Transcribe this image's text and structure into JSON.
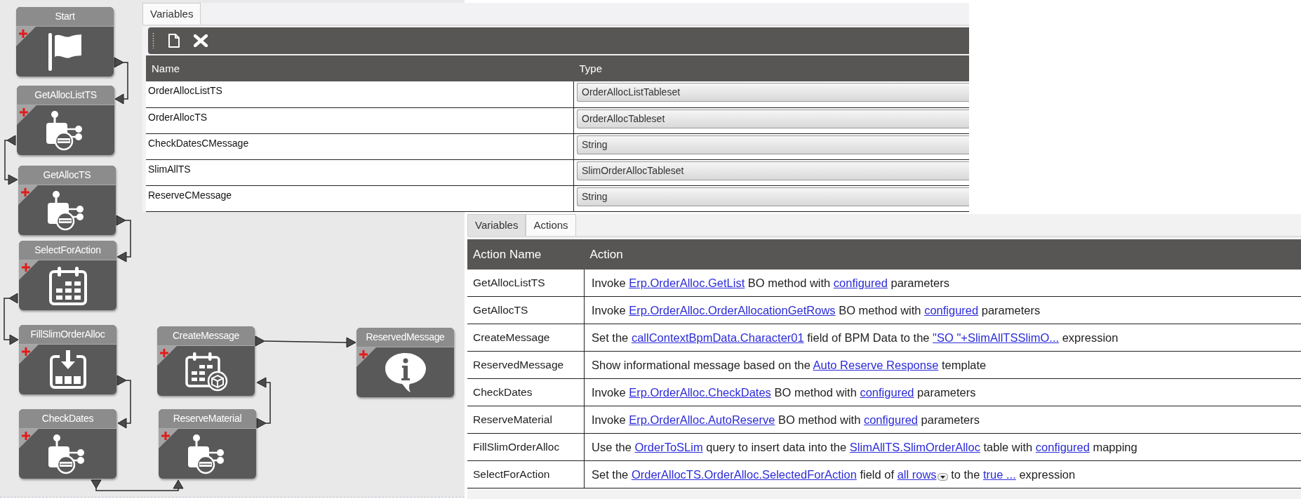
{
  "canvas": {
    "nodes": [
      {
        "title": "Start",
        "kind": "start"
      },
      {
        "title": "GetAllocListTS",
        "kind": "method"
      },
      {
        "title": "GetAllocTS",
        "kind": "method"
      },
      {
        "title": "SelectForAction",
        "kind": "set-argument"
      },
      {
        "title": "FillSlimOrderAlloc",
        "kind": "fill-table"
      },
      {
        "title": "CheckDates",
        "kind": "method"
      },
      {
        "title": "CreateMessage",
        "kind": "set-field"
      },
      {
        "title": "ReserveMaterial",
        "kind": "method"
      },
      {
        "title": "ReservedMessage",
        "kind": "message"
      }
    ]
  },
  "variables_panel": {
    "tabs": [
      {
        "label": "Variables",
        "selected": true
      }
    ],
    "columns": [
      "Name",
      "Type"
    ],
    "rows": [
      {
        "name": "OrderAllocListTS",
        "type": "OrderAllocListTableset"
      },
      {
        "name": "OrderAllocTS",
        "type": "OrderAllocTableset"
      },
      {
        "name": "CheckDatesCMessage",
        "type": "String"
      },
      {
        "name": "SlimAllTS",
        "type": "SlimOrderAllocTableset"
      },
      {
        "name": "ReserveCMessage",
        "type": "String"
      }
    ]
  },
  "actions_panel": {
    "tabs": [
      {
        "label": "Variables",
        "selected": false
      },
      {
        "label": "Actions",
        "selected": true
      }
    ],
    "columns": [
      "Action Name",
      "Action"
    ],
    "rows": [
      {
        "name": "GetAllocListTS",
        "action": [
          {
            "kind": "text",
            "text": "Invoke "
          },
          {
            "kind": "link",
            "text": "Erp.OrderAlloc.GetList"
          },
          {
            "kind": "text",
            "text": " BO method with "
          },
          {
            "kind": "link",
            "text": "configured"
          },
          {
            "kind": "text",
            "text": " parameters"
          }
        ]
      },
      {
        "name": "GetAllocTS",
        "action": [
          {
            "kind": "text",
            "text": "Invoke "
          },
          {
            "kind": "link",
            "text": "Erp.OrderAlloc.OrderAllocationGetRows"
          },
          {
            "kind": "text",
            "text": " BO method with "
          },
          {
            "kind": "link",
            "text": "configured"
          },
          {
            "kind": "text",
            "text": " parameters"
          }
        ]
      },
      {
        "name": "CreateMessage",
        "action": [
          {
            "kind": "text",
            "text": "Set the "
          },
          {
            "kind": "link",
            "text": "callContextBpmData.Character01"
          },
          {
            "kind": "text",
            "text": " field of BPM Data to the "
          },
          {
            "kind": "link",
            "text": "\"SO \"+SlimAllTSSlimO..."
          },
          {
            "kind": "text",
            "text": " expression"
          }
        ]
      },
      {
        "name": "ReservedMessage",
        "action": [
          {
            "kind": "text",
            "text": "Show informational message based on the "
          },
          {
            "kind": "link",
            "text": "Auto Reserve Response"
          },
          {
            "kind": "text",
            "text": " template"
          }
        ]
      },
      {
        "name": "CheckDates",
        "action": [
          {
            "kind": "text",
            "text": "Invoke "
          },
          {
            "kind": "link",
            "text": "Erp.OrderAlloc.CheckDates"
          },
          {
            "kind": "text",
            "text": " BO method with "
          },
          {
            "kind": "link",
            "text": "configured"
          },
          {
            "kind": "text",
            "text": " parameters"
          }
        ]
      },
      {
        "name": "ReserveMaterial",
        "action": [
          {
            "kind": "text",
            "text": "Invoke "
          },
          {
            "kind": "link",
            "text": "Erp.OrderAlloc.AutoReserve"
          },
          {
            "kind": "text",
            "text": " BO method with "
          },
          {
            "kind": "link",
            "text": "configured"
          },
          {
            "kind": "text",
            "text": " parameters"
          }
        ]
      },
      {
        "name": "FillSlimOrderAlloc",
        "action": [
          {
            "kind": "text",
            "text": "Use the "
          },
          {
            "kind": "link",
            "text": "OrderToSLim"
          },
          {
            "kind": "text",
            "text": " query to insert data into the "
          },
          {
            "kind": "link",
            "text": "SlimAllTS.SlimOrderAlloc"
          },
          {
            "kind": "text",
            "text": " table with "
          },
          {
            "kind": "link",
            "text": "configured"
          },
          {
            "kind": "text",
            "text": " mapping"
          }
        ]
      },
      {
        "name": "SelectForAction",
        "action": [
          {
            "kind": "text",
            "text": "Set the "
          },
          {
            "kind": "link",
            "text": "OrderAllocTS.OrderAlloc.SelectedForAction"
          },
          {
            "kind": "text",
            "text": " field of "
          },
          {
            "kind": "menu-link",
            "text": "all rows"
          },
          {
            "kind": "text",
            "text": " to the "
          },
          {
            "kind": "link",
            "text": "true ..."
          },
          {
            "kind": "text",
            "text": " expression"
          }
        ]
      }
    ]
  }
}
